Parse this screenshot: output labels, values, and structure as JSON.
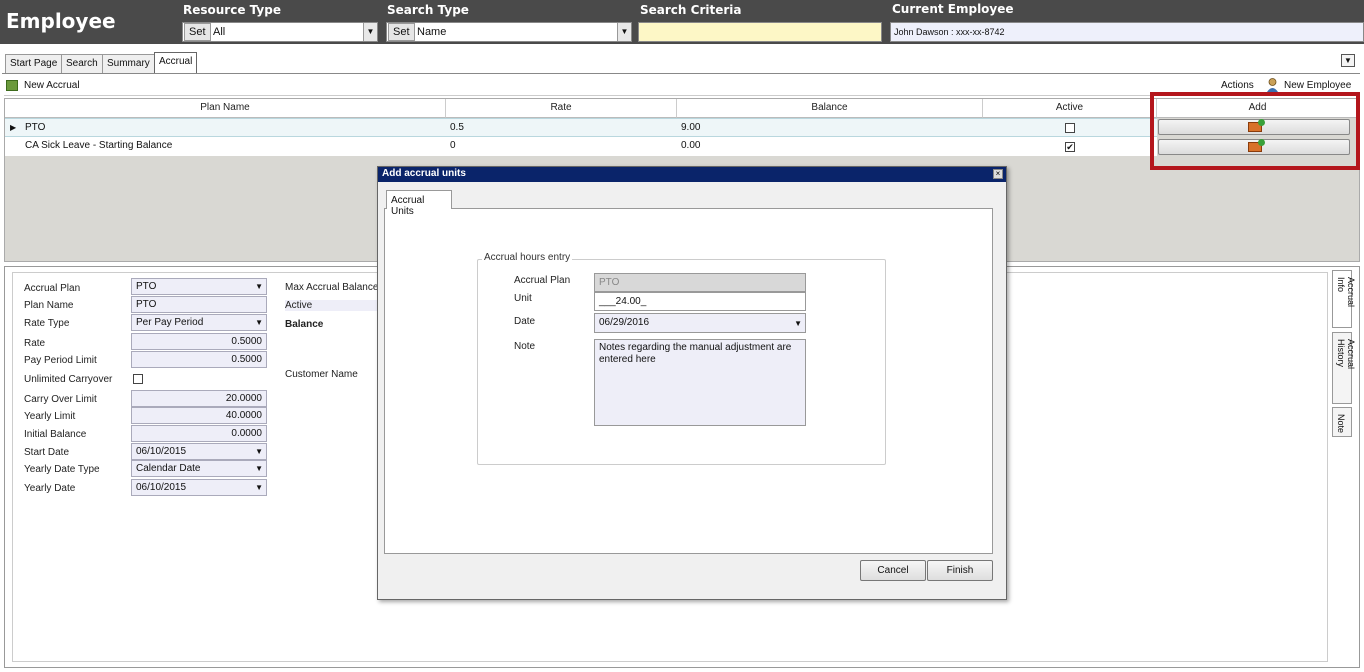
{
  "header": {
    "app_title": "Employee",
    "resource_type": {
      "label": "Resource Type",
      "set_label": "Set",
      "value": "All"
    },
    "search_type": {
      "label": "Search Type",
      "set_label": "Set",
      "value": "Name"
    },
    "search_criteria": {
      "label": "Search Criteria",
      "value": ""
    },
    "current_employee": {
      "label": "Current Employee",
      "value": "John  Dawson : xxx-xx-8742"
    }
  },
  "tabs": [
    "Start Page",
    "Search",
    "Summary",
    "Accrual"
  ],
  "toolbar": {
    "new_accrual": "New Accrual",
    "actions": "Actions",
    "new_employee": "New Employee"
  },
  "grid": {
    "columns": [
      "Plan Name",
      "Rate",
      "Balance",
      "Active",
      "Add"
    ],
    "rows": [
      {
        "plan_name": "PTO",
        "rate": "0.5",
        "balance": "9.00",
        "active": false
      },
      {
        "plan_name": "CA Sick Leave - Starting Balance",
        "rate": "0",
        "balance": "0.00",
        "active": true
      }
    ]
  },
  "detail": {
    "accrual_plan": {
      "label": "Accrual Plan",
      "value": "PTO"
    },
    "plan_name": {
      "label": "Plan Name",
      "value": "PTO"
    },
    "rate_type": {
      "label": "Rate Type",
      "value": "Per Pay Period"
    },
    "rate": {
      "label": "Rate",
      "value": "0.5000"
    },
    "pay_period_limit": {
      "label": "Pay Period Limit",
      "value": "0.5000"
    },
    "unlimited_carryover": {
      "label": "Unlimited Carryover"
    },
    "carry_over_limit": {
      "label": "Carry Over Limit",
      "value": "20.0000"
    },
    "yearly_limit": {
      "label": "Yearly Limit",
      "value": "40.0000"
    },
    "initial_balance": {
      "label": "Initial Balance",
      "value": "0.0000"
    },
    "start_date": {
      "label": "Start Date",
      "value": "06/10/2015"
    },
    "yearly_date_type": {
      "label": "Yearly Date Type",
      "value": "Calendar Date"
    },
    "yearly_date": {
      "label": "Yearly Date",
      "value": "06/10/2015"
    },
    "max_accrual_balance": "Max Accrual Balance",
    "active": "Active",
    "balance": "Balance",
    "customer_name": "Customer Name"
  },
  "side_tabs": [
    "Accrual Info",
    "Accrual History",
    "Note"
  ],
  "modal": {
    "title": "Add accrual units",
    "close": "×",
    "tab": "Accrual Units",
    "legend": "Accrual hours entry",
    "accrual_plan": {
      "label": "Accrual Plan",
      "value": "PTO"
    },
    "unit": {
      "label": "Unit",
      "value": "___24.00_"
    },
    "date": {
      "label": "Date",
      "value": "06/29/2016"
    },
    "note": {
      "label": "Note",
      "value": "Notes regarding the manual adjustment are entered here"
    },
    "cancel": "Cancel",
    "finish": "Finish"
  },
  "colors": {
    "header_bg": "#4a4a4a",
    "modal_title_bg": "#0a246a",
    "highlight": "#b4161c",
    "search_criteria_bg": "#fdf7c6"
  }
}
